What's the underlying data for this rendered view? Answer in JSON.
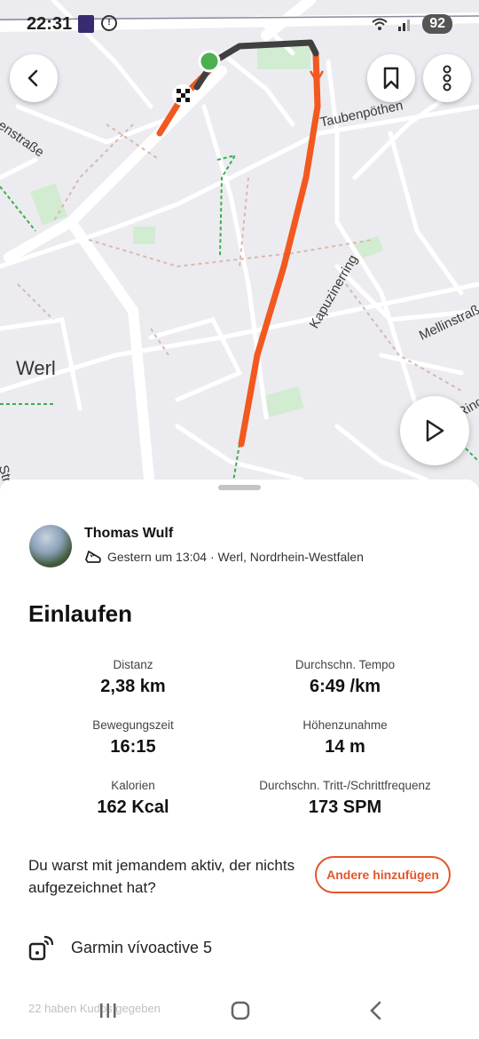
{
  "status_bar": {
    "time": "22:31",
    "battery": "92"
  },
  "map": {
    "streets": {
      "taubenpoethen": "Taubenpöthen",
      "enstrasse": "enstraße",
      "kapuzinerring": "Kapuzinerring",
      "mellinstr": "Mellinstraß",
      "city": "Werl",
      "str_edge": "Str",
      "ring_edge": "Ring"
    }
  },
  "activity": {
    "user": "Thomas Wulf",
    "meta": "Gestern um 13:04 · Werl, Nordrhein-Westfalen",
    "title": "Einlaufen",
    "stats": [
      {
        "label": "Distanz",
        "value": "2,38 km"
      },
      {
        "label": "Durchschn. Tempo",
        "value": "6:49 /km"
      },
      {
        "label": "Bewegungszeit",
        "value": "16:15"
      },
      {
        "label": "Höhenzunahme",
        "value": "14 m"
      },
      {
        "label": "Kalorien",
        "value": "162 Kcal"
      },
      {
        "label": "Durchschn. Tritt-/Schrittfrequenz",
        "value": "173 SPM"
      }
    ],
    "prompt": "Du warst mit jemandem aktiv, der nichts aufgezeichnet hat?",
    "add_button": "Andere hinzufügen",
    "device": "Garmin vívoactive 5",
    "kudos": "22 haben Kudos gegeben"
  },
  "colors": {
    "route": "#f2581f",
    "route_dark": "#404040",
    "accent": "#e2572b",
    "park": "#d2ecd2"
  },
  "icons": [
    "back-icon",
    "bookmark-icon",
    "more-icon",
    "play-icon",
    "shoe-icon",
    "device-icon",
    "recent-apps-icon",
    "home-icon",
    "nav-back-icon"
  ]
}
